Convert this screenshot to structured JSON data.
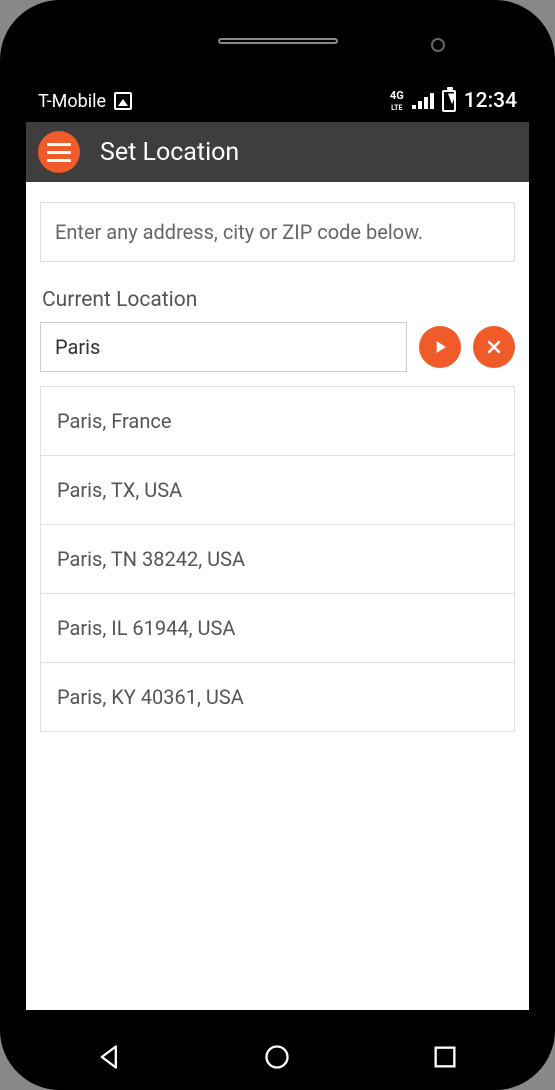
{
  "statusbar": {
    "carrier": "T-Mobile",
    "network_indicator": "4G LTE",
    "time": "12:34"
  },
  "header": {
    "title": "Set Location"
  },
  "instruction": "Enter any address, city or ZIP code below.",
  "section_label": "Current Location",
  "input": {
    "value": "Paris",
    "placeholder": ""
  },
  "suggestions": [
    "Paris, France",
    "Paris, TX, USA",
    "Paris, TN 38242, USA",
    "Paris, IL 61944, USA",
    "Paris, KY 40361, USA"
  ],
  "colors": {
    "accent": "#f15a29",
    "header_bg": "#3f3d3d"
  }
}
